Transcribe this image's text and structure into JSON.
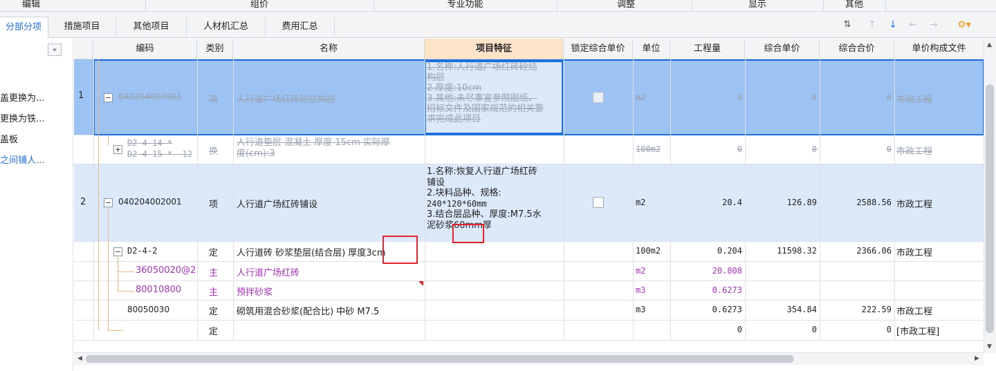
{
  "ribbon": [
    "编辑",
    "组价",
    "专业功能",
    "调整",
    "显示",
    "其他"
  ],
  "tabs": [
    "分部分项",
    "措施项目",
    "其他项目",
    "人材机汇总",
    "费用汇总"
  ],
  "left_panel": {
    "collapse": "«",
    "items": [
      "盖更换为...",
      "更换为铁...",
      "盖板",
      "之间铺人..."
    ]
  },
  "columns": [
    "编码",
    "类别",
    "名称",
    "项目特征",
    "锁定综合单价",
    "单位",
    "工程量",
    "综合单价",
    "综合合价",
    "单价构成文件"
  ],
  "rows": [
    {
      "num": "1",
      "code": "040204003001",
      "type": "项",
      "name": "人行道广场红砖砼结构层",
      "feature": [
        "1.名称:人行道广场红砖砼结",
        "构层",
        "2.厚度:10cm",
        "3.其他:未尽事宜参照图纸、",
        "招标文件及国家规范的相关要",
        "求完成此项目"
      ],
      "unit": "m2",
      "qty": "0",
      "price": "0",
      "total": "0",
      "file": "市政工程"
    },
    {
      "code": [
        "D2-4-14 *",
        "D2-4-15 * -12"
      ],
      "type": "换",
      "name": [
        "人行道垫层 混凝土 厚度 15cm  实际厚",
        "度(cm):3"
      ],
      "unit": "100m2",
      "qty": "0",
      "price": "0",
      "total": "0",
      "file": "市政工程"
    },
    {
      "num": "2",
      "code": "040204002001",
      "type": "项",
      "name": "人行道广场红砖铺设",
      "feature": [
        "1.名称:恢复人行道广场红砖",
        "铺设",
        "2.块料品种、规格:",
        "240*120*60mm",
        "3.结合层品种、厚度:M7.5水",
        "泥砂浆60mm厚"
      ],
      "unit": "m2",
      "qty": "20.4",
      "price": "126.89",
      "total": "2588.56",
      "file": "市政工程"
    },
    {
      "code": "D2-4-2",
      "type": "定",
      "name": "人行道砖 砂浆垫层(结合层) 厚度3cm",
      "unit": "100m2",
      "qty": "0.204",
      "price": "11598.32",
      "total": "2366.06",
      "file": "市政工程"
    },
    {
      "code": "36050020@2",
      "type": "主",
      "name": "人行道广场红砖",
      "unit": "m2",
      "qty": "20.808"
    },
    {
      "code": "80010800",
      "type": "主",
      "name": "预拌砂浆",
      "unit": "m3",
      "qty": "0.6273"
    },
    {
      "code": "80050030",
      "type": "定",
      "name": "砌筑用混合砂浆(配合比) 中砂 M7.5",
      "unit": "m3",
      "qty": "0.6273",
      "price": "354.84",
      "total": "222.59",
      "file": "市政工程"
    },
    {
      "type": "定",
      "qty": "0",
      "price": "0",
      "total": "0",
      "file": "[市政工程]"
    }
  ],
  "colors": {
    "selected_row": "#9dc3f5",
    "light_row": "#dce9fb",
    "highlight_header": "#fde4c8",
    "accent": "#1d6fe0",
    "annotation": "#e3222b",
    "main_material": "#a532b8"
  }
}
